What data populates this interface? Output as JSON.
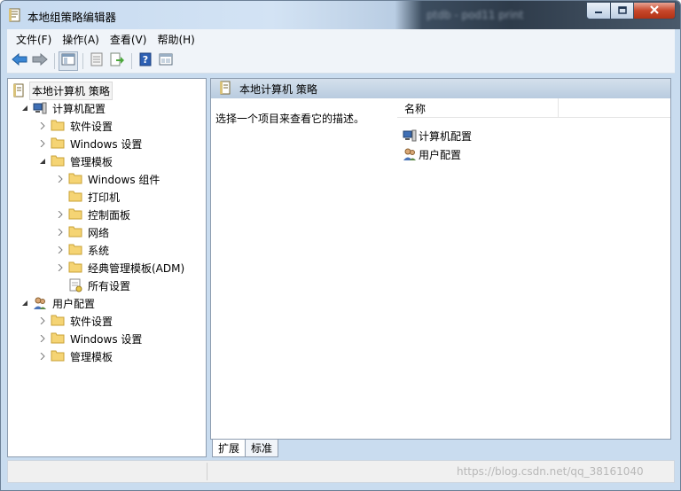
{
  "window": {
    "title": "本地组策略编辑器",
    "background_title_blurred": "ptdb - pod11 print"
  },
  "menu": [
    {
      "label": "文件(F)"
    },
    {
      "label": "操作(A)"
    },
    {
      "label": "查看(V)"
    },
    {
      "label": "帮助(H)"
    }
  ],
  "toolbar": {
    "buttons": [
      "back-icon",
      "forward-icon",
      "show-hide-tree-icon",
      "properties-icon",
      "export-list-icon",
      "help-icon",
      "console-icon"
    ]
  },
  "tree": {
    "root": "本地计算机 策略",
    "computer": "计算机配置",
    "computer_software": "软件设置",
    "computer_windows": "Windows 设置",
    "computer_admin": "管理模板",
    "admin_windows_components": "Windows 组件",
    "admin_printers": "打印机",
    "admin_control_panel": "控制面板",
    "admin_network": "网络",
    "admin_system": "系统",
    "admin_classic": "经典管理模板(ADM)",
    "admin_all_settings": "所有设置",
    "user": "用户配置",
    "user_software": "软件设置",
    "user_windows": "Windows 设置",
    "user_admin": "管理模板"
  },
  "right_pane": {
    "header": "本地计算机 策略",
    "description": "选择一个项目来查看它的描述。",
    "column_name": "名称",
    "items": [
      {
        "label": "计算机配置"
      },
      {
        "label": "用户配置"
      }
    ]
  },
  "tabs": [
    {
      "label": "扩展",
      "active": true
    },
    {
      "label": "标准",
      "active": false
    }
  ],
  "status": {
    "watermark": "https://blog.csdn.net/qq_38161040"
  },
  "colors": {
    "selection_header": "#b8cbdf",
    "folder": "#f5d474",
    "close_button": "#c7472b"
  }
}
